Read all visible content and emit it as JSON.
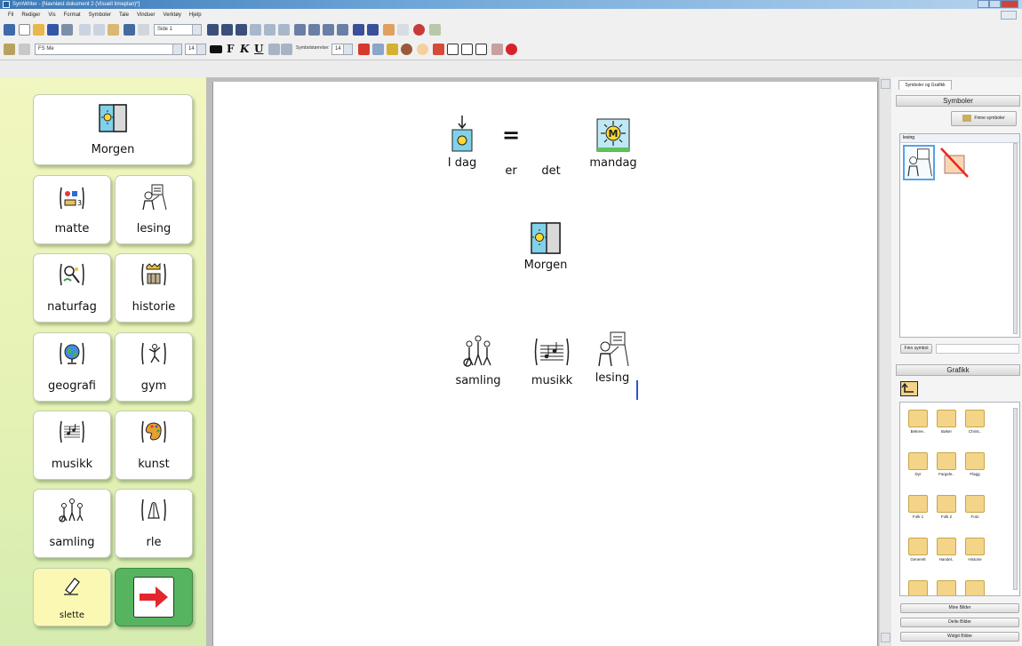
{
  "window": {
    "title": "SymWriter - [Navnløst dokument 2 (Visuell timeplan)*]"
  },
  "menu": [
    "Fil",
    "Rediger",
    "Vis",
    "Format",
    "Symboler",
    "Tale",
    "Vinduer",
    "Verktøy",
    "Hjelp"
  ],
  "toolbar": {
    "page_combo": "Side 1",
    "font_name": "FS Me",
    "font_size": "14",
    "bold": "F",
    "italic": "K",
    "underline": "U",
    "symbol_size_label": "Symbolstørrelse:",
    "symbol_size": "14"
  },
  "grid": {
    "cells": [
      {
        "label": "Morgen",
        "icon": "morning-window-icon"
      },
      {
        "label": "matte",
        "icon": "math-icon"
      },
      {
        "label": "lesing",
        "icon": "reading-icon"
      },
      {
        "label": "naturfag",
        "icon": "science-icon"
      },
      {
        "label": "historie",
        "icon": "history-icon"
      },
      {
        "label": "geografi",
        "icon": "globe-icon"
      },
      {
        "label": "gym",
        "icon": "gym-icon"
      },
      {
        "label": "musikk",
        "icon": "music-icon"
      },
      {
        "label": "kunst",
        "icon": "art-icon"
      },
      {
        "label": "samling",
        "icon": "gathering-icon"
      },
      {
        "label": "rle",
        "icon": "praying-hands-icon"
      },
      {
        "label": "slette",
        "icon": "eraser-icon"
      },
      {
        "label": "",
        "icon": "next-arrow-icon"
      }
    ]
  },
  "document": {
    "line1": {
      "words": [
        "I dag",
        "er",
        "det",
        "mandag"
      ],
      "equals": "=",
      "monday_letter": "M"
    },
    "line2": {
      "word": "Morgen"
    },
    "line3": {
      "words": [
        "samling",
        "musikk",
        "lesing"
      ]
    }
  },
  "right_panel": {
    "tab": "Symboler og Grafikk",
    "symbols_header": "Symboler",
    "find_symbols_button": "Finne symboler",
    "list_caption": "lesing",
    "find_symbol_button": "Finn symbol",
    "graphics_header": "Grafikk",
    "folders": [
      "Bekree..",
      "Bøker",
      "Christ..",
      "Dyr",
      "Fargele..",
      "Flagg",
      "Folk 1",
      "Folk 2",
      "Foto",
      "Generelt",
      "Handel..",
      "Historie"
    ],
    "my_images_button": "Mine Bilder",
    "shared_images_button": "Delte Bilder",
    "widgit_images_button": "Widgit Bilder"
  },
  "colors": {
    "grid_bg_top": "#f2f6c0",
    "grid_bg_bottom": "#d5ecb0",
    "next_button_bg": "#56b460",
    "slette_bg": "#fbf8b4",
    "cursor": "#2b56d6"
  }
}
